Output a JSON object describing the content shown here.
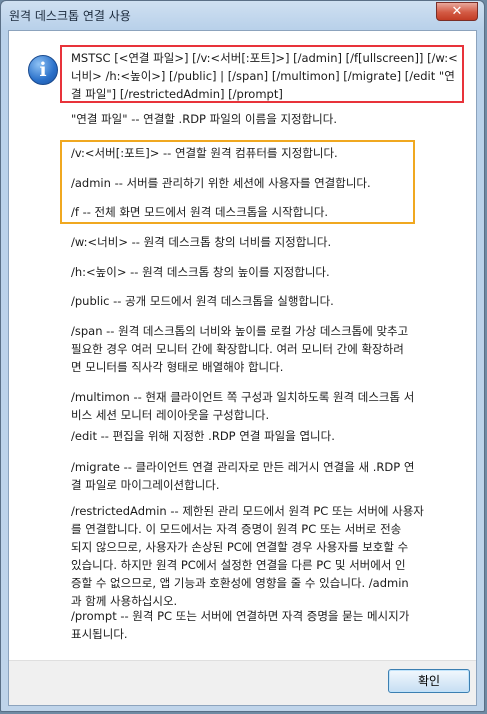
{
  "window": {
    "title": "원격 데스크톱 연결 사용",
    "close_glyph": "✕",
    "icon": "info-icon"
  },
  "content": {
    "usage": "MSTSC [<연결 파일>] [/v:<서버[:포트]>] [/admin] [/f[ullscreen]] [/w:<\n너비> /h:<높이>] [/public] | [/span] [/multimon] [/migrate] [/edit \"연\n결 파일\"] [/restrictedAdmin] [/prompt]",
    "connection_file": "\"연결 파일\" -- 연결할 .RDP 파일의 이름을 지정합니다.",
    "v": "/v:<서버[:포트]> -- 연결할 원격 컴퓨터를 지정합니다.",
    "admin": "/admin -- 서버를 관리하기 위한 세션에 사용자를 연결합니다.",
    "f": "/f -- 전체 화면 모드에서 원격 데스크톱을 시작합니다.",
    "w": "/w:<너비> -- 원격 데스크톱 창의 너비를 지정합니다.",
    "h": "/h:<높이> -- 원격 데스크톱 창의 높이를 지정합니다.",
    "public": "/public -- 공개 모드에서 원격 데스크톱을 실행합니다.",
    "span": "/span -- 원격 데스크톱의 너비와 높이를 로컬 가상 데스크톱에 맞추고\n필요한 경우 여러 모니터 간에 확장합니다. 여러 모니터 간에 확장하려\n면 모니터를 직사각 형태로 배열해야 합니다.",
    "multimon": "/multimon -- 현재 클라이언트 쪽 구성과 일치하도록 원격 데스크톱 서\n비스 세션 모니터 레이아웃을 구성합니다.",
    "edit": "/edit -- 편집을 위해 지정한 .RDP 연결 파일을 엽니다.",
    "migrate": "/migrate -- 클라이언트 연결 관리자로 만든 레거시 연결을 새 .RDP 연\n결 파일로 마이그레이션합니다.",
    "restricted_admin": "/restrictedAdmin -- 제한된 관리 모드에서 원격 PC 또는 서버에 사용자\n를 연결합니다. 이 모드에서는 자격 증명이 원격 PC 또는 서버로 전송\n되지 않으므로, 사용자가 손상된 PC에 연결할 경우 사용자를 보호할 수\n있습니다. 하지만 원격 PC에서 설정한 연결을 다른 PC 및 서버에서 인\n증할 수 없으므로, 앱 기능과 호환성에 영향을 줄 수 있습니다. /admin\n과 함께 사용하십시오.",
    "prompt": "/prompt -- 원격 PC 또는 서버에 연결하면 자격 증명을 묻는 메시지가\n표시됩니다."
  },
  "footer": {
    "ok_label": "확인"
  },
  "colors": {
    "highlight_red": "#e8333a",
    "highlight_orange": "#f0a820"
  }
}
